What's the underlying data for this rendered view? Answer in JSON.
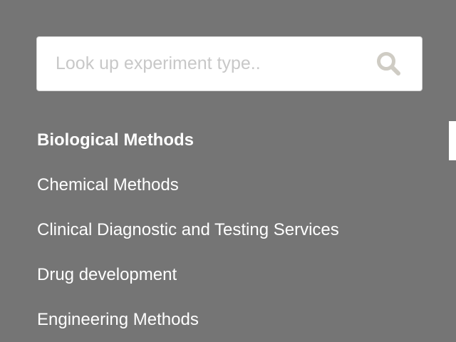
{
  "search": {
    "placeholder": "Look up experiment type..",
    "value": "",
    "icon": "search-icon"
  },
  "categories": [
    {
      "label": "Biological Methods",
      "active": true
    },
    {
      "label": "Chemical Methods",
      "active": false
    },
    {
      "label": "Clinical Diagnostic and Testing Services",
      "active": false
    },
    {
      "label": "Drug development",
      "active": false
    },
    {
      "label": "Engineering Methods",
      "active": false
    }
  ],
  "colors": {
    "background": "#757575",
    "text": "#ffffff",
    "search_icon": "#cfccc4",
    "placeholder": "#c8c8c8"
  }
}
